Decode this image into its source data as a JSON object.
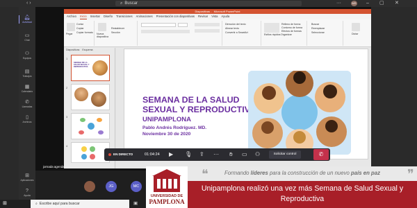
{
  "teams": {
    "search_placeholder": "Buscar",
    "more_label": "···",
    "avatar_initials": "MS",
    "win_minimize": "–",
    "win_maximize": "▢",
    "win_close": "✕",
    "rail": [
      {
        "label": "Actividad",
        "icon": "bell-icon"
      },
      {
        "label": "Chat",
        "icon": "chat-icon"
      },
      {
        "label": "Equipos",
        "icon": "teams-icon"
      },
      {
        "label": "Trabajos",
        "icon": "assignments-icon"
      },
      {
        "label": "Calendario",
        "icon": "calendar-icon"
      },
      {
        "label": "Llamadas",
        "icon": "phone-icon"
      },
      {
        "label": "Archivos",
        "icon": "files-icon"
      },
      {
        "label": "Aplicaciones",
        "icon": "apps-icon"
      },
      {
        "label": "Ayuda",
        "icon": "help-icon"
      }
    ]
  },
  "powerpoint": {
    "window_title": "Diapositivas",
    "app_name": "Microsoft PowerPoint",
    "tabs": [
      "Archivo",
      "Inicio",
      "Insertar",
      "Diseño",
      "Transiciones",
      "Animaciones",
      "Presentación con diapositivas",
      "Revisar",
      "Vista",
      "Ayuda"
    ],
    "selected_tab": "Inicio",
    "ribbon": {
      "paste": "Pegar",
      "cut": "Cortar",
      "copy": "Copiar",
      "format_painter": "Copiar formato",
      "new_slide": "Nueva diapositiva",
      "reset": "Restablecer",
      "section": "Sección",
      "text_direction": "Dirección del texto",
      "align_text": "Alinear texto",
      "convert_smartart": "Convertir a SmartArt",
      "arrange": "Organizar",
      "quick_styles": "Estilos rápidos",
      "shape_fill": "Relleno de forma",
      "shape_outline": "Contorno de forma",
      "shape_effects": "Efectos de formas",
      "find": "Buscar",
      "replace": "Reemplazar",
      "select": "Seleccionar",
      "dictate": "Dictar"
    },
    "thumbs_tabs": [
      "Diapositivas",
      "Esquema"
    ],
    "thumbnails": [
      {
        "num": "1",
        "text": "SEMANA DE LA SALUD SEXUAL Y REPRODUCTIVA"
      },
      {
        "num": "2",
        "text": ""
      },
      {
        "num": "3",
        "text": ""
      },
      {
        "num": "4",
        "text": ""
      },
      {
        "num": "5",
        "text": ""
      }
    ],
    "slide": {
      "title": "SEMANA DE LA SALUD SEXUAL Y REPRODUCTIVA",
      "subtitle": "UNIPAMPLONA",
      "author": "Pablo Andrés Rodríguez. MD.",
      "date": "Noviembre 30 de 2020"
    }
  },
  "meeting": {
    "live_label": "EN DIRECTO",
    "timer": "01:04:24",
    "request_control": "Solicitar control",
    "hangup_icon": "phone-hangup-icon",
    "presenter_caption": "jornada agenda",
    "live_small": "EN DIRECTO",
    "participants": [
      {
        "initials": "",
        "color": "#8a5a44"
      },
      {
        "initials": "JG",
        "color": "#5b5fc7"
      },
      {
        "initials": "MC",
        "color": "#5b5fc7"
      }
    ]
  },
  "taskbar": {
    "search_placeholder": "Escribe aquí para buscar"
  },
  "news": {
    "logo_line1": "UNIVERSIDAD DE",
    "logo_line2": "PAMPLONA",
    "slogan_pre": "Formando ",
    "slogan_b1": "líderes",
    "slogan_mid": " para la construcción de un nuevo ",
    "slogan_b2": "país en paz",
    "headline": "Unipamplona realizó una vez más Semana de Salud Sexual y Reproductiva",
    "colors": {
      "band_red": "#a81f28",
      "band_grey": "#e9e9e9"
    }
  }
}
